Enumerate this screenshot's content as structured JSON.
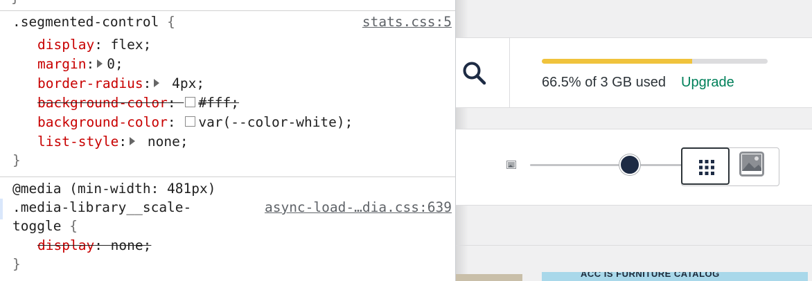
{
  "devtools": {
    "prev_rule_brace": "}",
    "rule1": {
      "selector": ".segmented-control",
      "open_brace": "{",
      "close_brace": "}",
      "source": "stats.css:5",
      "declarations": [
        {
          "prop": "display",
          "value": "flex;",
          "expandable": false,
          "swatch": false,
          "overridden": false
        },
        {
          "prop": "margin",
          "value": "0;",
          "expandable": true,
          "swatch": false,
          "overridden": false
        },
        {
          "prop": "border-radius",
          "value": "4px;",
          "expandable": true,
          "swatch": false,
          "overridden": false
        },
        {
          "prop": "background-color",
          "value": "#fff;",
          "expandable": false,
          "swatch": true,
          "overridden": true
        },
        {
          "prop": "background-color",
          "value": "var(--color-white);",
          "expandable": false,
          "swatch": true,
          "overridden": false
        },
        {
          "prop": "list-style",
          "value": "none;",
          "expandable": true,
          "swatch": false,
          "overridden": false
        }
      ]
    },
    "rule2": {
      "media": "@media (min-width: 481px)",
      "selector_line1": ".media-library__scale-",
      "selector_line2": "toggle",
      "open_brace": "{",
      "close_brace": "}",
      "source": "async-load-…dia.css:639",
      "declarations": [
        {
          "prop": "display",
          "value": "none;",
          "overridden": true
        }
      ]
    }
  },
  "storage": {
    "used_fraction": 0.665,
    "text": "66.5% of 3 GB used",
    "upgrade_label": "Upgrade",
    "fill_color": "#f0c33c"
  },
  "scale": {
    "slider_value_fraction": 0.48
  },
  "thumbnail_caption": "ACC IS FURNITURE CATALOG",
  "colors": {
    "property": "#c80000",
    "link": "#00805a",
    "slider_thumb": "#1d2b44"
  },
  "icons": {
    "search": "search-icon",
    "small_image": "image-small-icon",
    "grid": "grid-view-icon",
    "large": "large-view-icon"
  }
}
